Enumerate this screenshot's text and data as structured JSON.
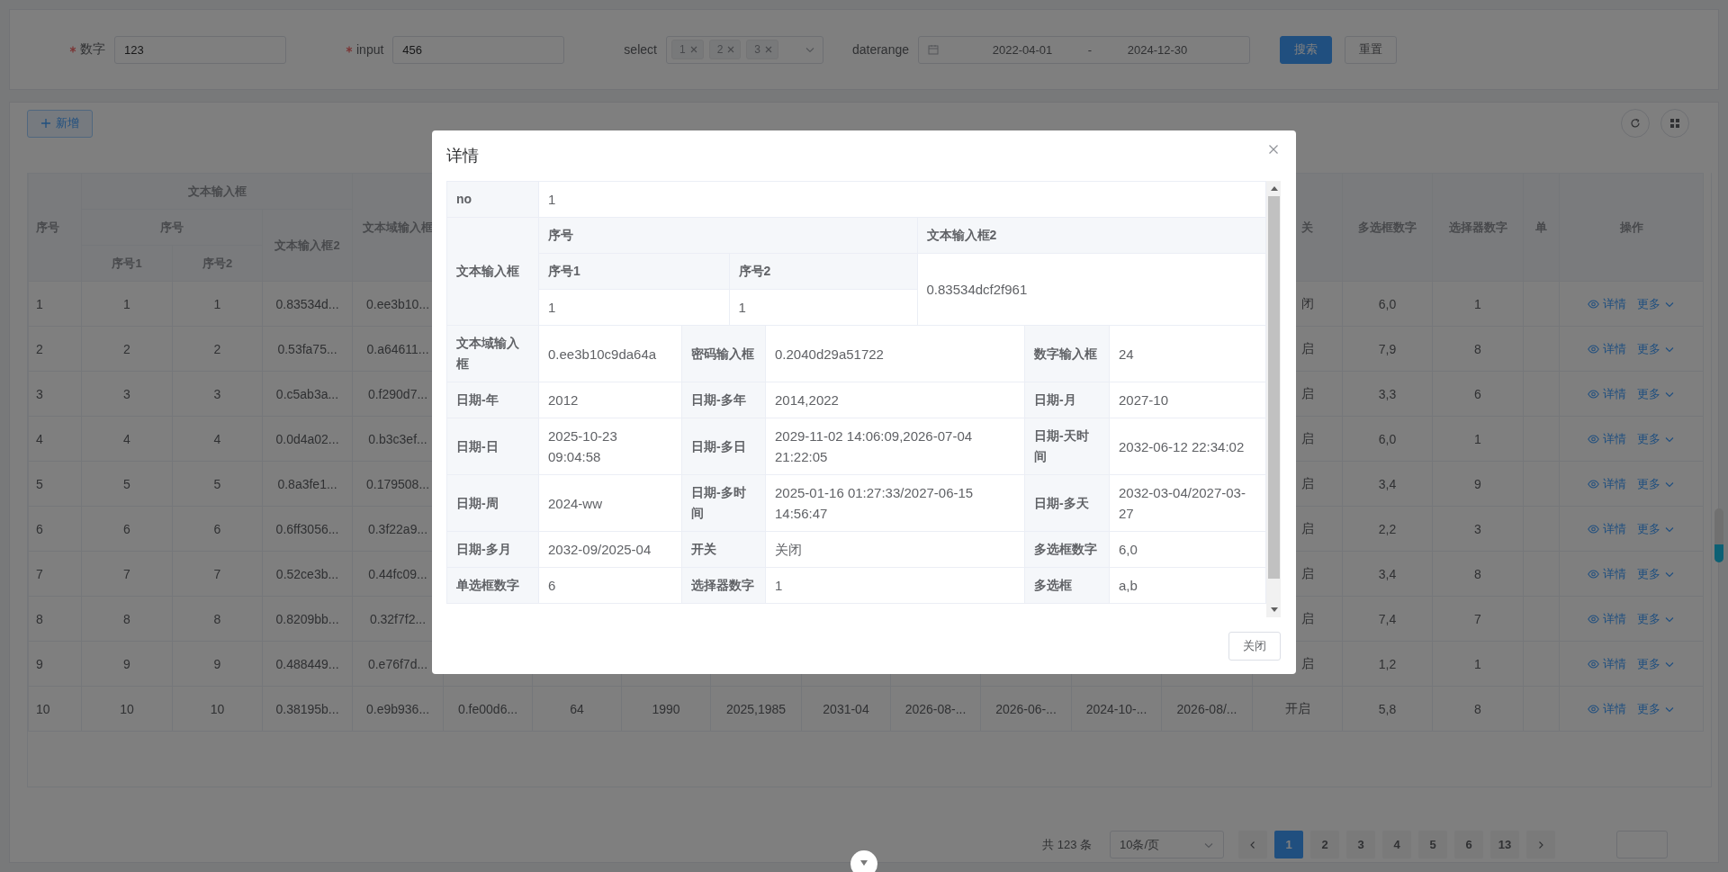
{
  "search_form": {
    "fields": [
      {
        "kind": "input",
        "label": "数字",
        "required": true,
        "value": "123"
      },
      {
        "kind": "input",
        "label": "input",
        "required": true,
        "value": "456"
      },
      {
        "kind": "select",
        "label": "select",
        "required": false,
        "tags": [
          "1",
          "2",
          "3"
        ]
      },
      {
        "kind": "daterange",
        "label": "daterange",
        "required": false,
        "start": "2022-04-01",
        "separator": "-",
        "end": "2024-12-30"
      }
    ],
    "buttons": [
      {
        "label": "搜索",
        "kind": "primary"
      },
      {
        "label": "重置",
        "kind": "default"
      }
    ]
  },
  "toolbar": {
    "add_button": "新增"
  },
  "table": {
    "header": {
      "index": "序号",
      "group": "文本输入框",
      "subgroup": "序号",
      "sub_columns": [
        "序号1",
        "序号2"
      ],
      "group_last": "文本输入框2",
      "textarea": "文本域输入框",
      "trailing": [
        "关",
        "多选框数字",
        "选择器数字",
        "单"
      ],
      "actions": "操作"
    },
    "rows": [
      {
        "cells": [
          "1",
          "1",
          "1",
          "0.83534d...",
          "0.ee3b10..."
        ],
        "trailing": [
          "闭",
          "6,0",
          "1"
        ],
        "actions": {
          "detail": "详情",
          "more": "更多"
        }
      },
      {
        "cells": [
          "2",
          "2",
          "2",
          "0.53fa75...",
          "0.a64611..."
        ],
        "trailing": [
          "启",
          "7,9",
          "8"
        ],
        "actions": {
          "detail": "详情",
          "more": "更多"
        }
      },
      {
        "cells": [
          "3",
          "3",
          "3",
          "0.c5ab3a...",
          "0.f290d7..."
        ],
        "trailing": [
          "启",
          "3,3",
          "6"
        ],
        "actions": {
          "detail": "详情",
          "more": "更多"
        }
      },
      {
        "cells": [
          "4",
          "4",
          "4",
          "0.0d4a02...",
          "0.b3c3ef..."
        ],
        "trailing": [
          "启",
          "6,0",
          "1"
        ],
        "actions": {
          "detail": "详情",
          "more": "更多"
        }
      },
      {
        "cells": [
          "5",
          "5",
          "5",
          "0.8a3fe1...",
          "0.179508..."
        ],
        "trailing": [
          "启",
          "3,4",
          "9"
        ],
        "actions": {
          "detail": "详情",
          "more": "更多"
        }
      },
      {
        "cells": [
          "6",
          "6",
          "6",
          "0.6ff3056...",
          "0.3f22a9..."
        ],
        "trailing": [
          "启",
          "2,2",
          "3"
        ],
        "actions": {
          "detail": "详情",
          "more": "更多"
        }
      },
      {
        "cells": [
          "7",
          "7",
          "7",
          "0.52ce3b...",
          "0.44fc09..."
        ],
        "trailing": [
          "启",
          "3,4",
          "8"
        ],
        "actions": {
          "detail": "详情",
          "more": "更多"
        }
      },
      {
        "cells": [
          "8",
          "8",
          "8",
          "0.8209bb...",
          "0.32f7f2..."
        ],
        "trailing": [
          "启",
          "7,4",
          "7"
        ],
        "actions": {
          "detail": "详情",
          "more": "更多"
        }
      },
      {
        "cells": [
          "9",
          "9",
          "9",
          "0.488449...",
          "0.e76f7d..."
        ],
        "trailing": [
          "启",
          "1,2",
          "1"
        ],
        "actions": {
          "detail": "详情",
          "more": "更多"
        }
      },
      {
        "cells": [
          "10",
          "10",
          "10",
          "0.38195b...",
          "0.e9b936..."
        ],
        "middle": [
          "0.fe00d6...",
          "64",
          "1990",
          "2025,1985",
          "2031-04",
          "2026-08-...",
          "2026-06-...",
          "2024-10-...",
          "2026-08/..."
        ],
        "trailing": [
          "开启",
          "5,8",
          "8"
        ],
        "actions": {
          "detail": "详情",
          "more": "更多"
        }
      }
    ]
  },
  "pagination": {
    "total": "共 123 条",
    "page_size": "10条/页",
    "pages": [
      {
        "label": "1",
        "selected": true
      },
      {
        "label": "2",
        "selected": false
      },
      {
        "label": "3",
        "selected": false
      },
      {
        "label": "4",
        "selected": false
      },
      {
        "label": "5",
        "selected": false
      },
      {
        "label": "6",
        "selected": false
      },
      {
        "label": "13",
        "selected": false
      }
    ]
  },
  "dialog": {
    "title": "详情",
    "rows": [
      {
        "kind": "full",
        "label": "no",
        "value": "1"
      },
      {
        "kind": "nested",
        "label": "文本输入框",
        "group": "序号",
        "subs": [
          {
            "label": "序号1",
            "value": "1"
          },
          {
            "label": "序号2",
            "value": "1"
          }
        ],
        "side": {
          "label": "文本输入框2",
          "value": "0.83534dcf2f961"
        }
      },
      {
        "kind": "triple",
        "items": [
          {
            "label": "文本域输入框",
            "value": "0.ee3b10c9da64a"
          },
          {
            "label": "密码输入框",
            "value": "0.2040d29a51722"
          },
          {
            "label": "数字输入框",
            "value": "24"
          }
        ]
      },
      {
        "kind": "triple",
        "items": [
          {
            "label": "日期-年",
            "value": "2012"
          },
          {
            "label": "日期-多年",
            "value": "2014,2022"
          },
          {
            "label": "日期-月",
            "value": "2027-10"
          }
        ]
      },
      {
        "kind": "triple",
        "items": [
          {
            "label": "日期-日",
            "value": "2025-10-23 09:04:58"
          },
          {
            "label": "日期-多日",
            "value": "2029-11-02 14:06:09,2026-07-04 21:22:05"
          },
          {
            "label": "日期-天时间",
            "value": "2032-06-12 22:34:02"
          }
        ]
      },
      {
        "kind": "triple",
        "items": [
          {
            "label": "日期-周",
            "value": "2024-ww"
          },
          {
            "label": "日期-多时间",
            "value": "2025-01-16 01:27:33/2027-06-15 14:56:47"
          },
          {
            "label": "日期-多天",
            "value": "2032-03-04/2027-03-27"
          }
        ]
      },
      {
        "kind": "triple",
        "items": [
          {
            "label": "日期-多月",
            "value": "2032-09/2025-04"
          },
          {
            "label": "开关",
            "value": "关闭"
          },
          {
            "label": "多选框数字",
            "value": "6,0"
          }
        ]
      },
      {
        "kind": "triple",
        "items": [
          {
            "label": "单选框数字",
            "value": "6"
          },
          {
            "label": "选择器数字",
            "value": "1"
          },
          {
            "label": "多选框",
            "value": "a,b"
          }
        ]
      }
    ],
    "footer_button": "关闭"
  }
}
